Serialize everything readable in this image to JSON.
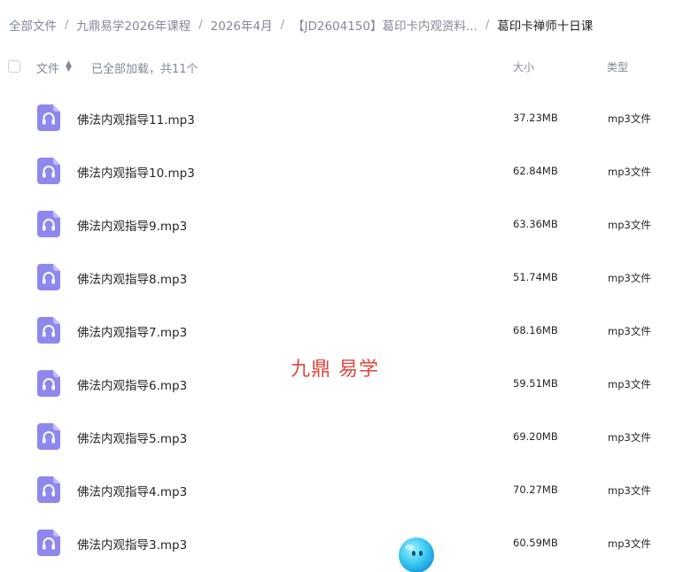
{
  "breadcrumb": [
    "全部文件",
    "九鼎易学2026年课程",
    "2026年4月",
    "【JD2604150】葛印卡内观资料...",
    "葛印卡禅师十日课"
  ],
  "header": {
    "name_label": "文件",
    "status": "已全部加载，共11个",
    "size_label": "大小",
    "type_label": "类型"
  },
  "files": [
    {
      "name": "佛法内观指导11.mp3",
      "size": "37.23MB",
      "type": "mp3文件"
    },
    {
      "name": "佛法内观指导10.mp3",
      "size": "62.84MB",
      "type": "mp3文件"
    },
    {
      "name": "佛法内观指导9.mp3",
      "size": "63.36MB",
      "type": "mp3文件"
    },
    {
      "name": "佛法内观指导8.mp3",
      "size": "51.74MB",
      "type": "mp3文件"
    },
    {
      "name": "佛法内观指导7.mp3",
      "size": "68.16MB",
      "type": "mp3文件"
    },
    {
      "name": "佛法内观指导6.mp3",
      "size": "59.51MB",
      "type": "mp3文件"
    },
    {
      "name": "佛法内观指导5.mp3",
      "size": "69.20MB",
      "type": "mp3文件"
    },
    {
      "name": "佛法内观指导4.mp3",
      "size": "70.27MB",
      "type": "mp3文件"
    },
    {
      "name": "佛法内观指导3.mp3",
      "size": "60.59MB",
      "type": "mp3文件"
    }
  ],
  "watermark": "九鼎 易学",
  "icons": {
    "file": "audio-file-icon",
    "sort": "sort-icon",
    "assistant": "assistant-mascot-icon"
  },
  "colors": {
    "accent_icon": "#8e88ee",
    "watermark": "#e0463d",
    "muted_text": "#818999"
  }
}
